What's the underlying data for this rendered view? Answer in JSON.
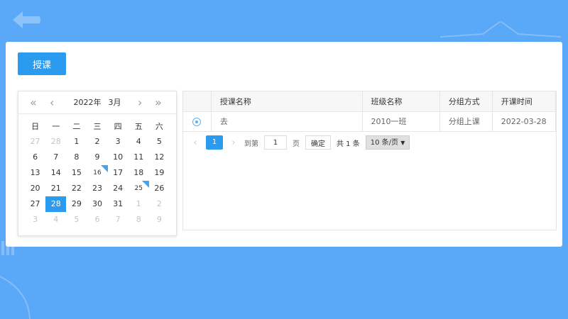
{
  "toolbar": {
    "teach_label": "授课"
  },
  "calendar": {
    "year": "2022年",
    "month": "3月",
    "nav": {
      "prev_year": "«",
      "prev_month": "‹",
      "next_month": "›",
      "next_year": "»"
    },
    "weekdays": [
      "日",
      "一",
      "二",
      "三",
      "四",
      "五",
      "六"
    ],
    "weeks": [
      [
        "27",
        "28",
        "1",
        "2",
        "3",
        "4",
        "5"
      ],
      [
        "6",
        "7",
        "8",
        "9",
        "10",
        "11",
        "12"
      ],
      [
        "13",
        "14",
        "15",
        "16",
        "17",
        "18",
        "19"
      ],
      [
        "20",
        "21",
        "22",
        "23",
        "24",
        "25",
        "26"
      ],
      [
        "27",
        "28",
        "29",
        "30",
        "31",
        "1",
        "2"
      ],
      [
        "3",
        "4",
        "5",
        "6",
        "7",
        "8",
        "9"
      ]
    ],
    "selected": "28"
  },
  "grid": {
    "columns": [
      "授课名称",
      "班级名称",
      "分组方式",
      "开课时间"
    ],
    "rows": [
      {
        "name": "去",
        "class": "2010一班",
        "group": "分组上课",
        "time": "2022-03-28"
      }
    ]
  },
  "pager": {
    "current_page": "1",
    "goto_label": "到第",
    "page_input": "1",
    "page_unit": "页",
    "confirm_label": "确定",
    "total_label": "共 1 条",
    "page_size": "10 条/页",
    "prev": "‹",
    "next": "›"
  },
  "colors": {
    "background": "#5aa8f8",
    "accent": "#2b9bf0"
  },
  "icons": {
    "back": "back-arrow-icon"
  }
}
